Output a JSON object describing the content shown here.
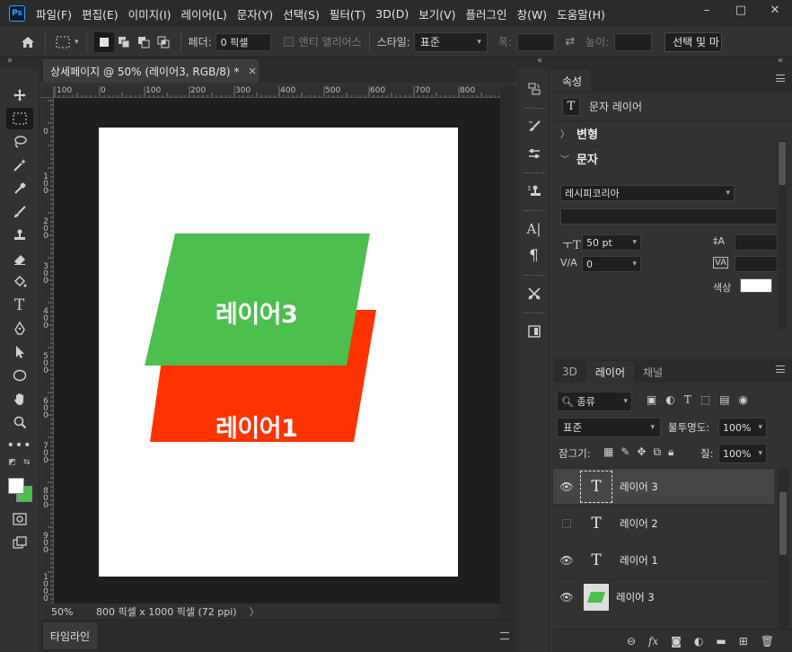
{
  "app": {
    "logo": "Ps",
    "menu": [
      "파일(F)",
      "편집(E)",
      "이미지(I)",
      "레이어(L)",
      "문자(Y)",
      "선택(S)",
      "필터(T)",
      "3D(D)",
      "보기(V)",
      "플러그인",
      "창(W)",
      "도움말(H)"
    ],
    "window_controls": [
      "–",
      "□",
      "✕"
    ]
  },
  "options": {
    "feather_label": "페더:",
    "feather_value": "0 픽셀",
    "antialias_label": "앤티 앨리어스",
    "style_label": "스타일:",
    "style_value": "표준",
    "width_label": "폭:",
    "height_label": "높이:",
    "select_mask_button": "선택 및 마"
  },
  "document": {
    "tab_title": "상세페이지 @ 50% (레이어3, RGB/8) *",
    "tab_close": "✕",
    "ruler_top": [
      "100",
      "0",
      "100",
      "200",
      "300",
      "400",
      "500",
      "600",
      "700",
      "800"
    ],
    "ruler_left": [
      "0",
      "1 0 0",
      "2 0 0",
      "3 0 0",
      "4 0 0",
      "5 0 0",
      "6 0 0",
      "7 0 0",
      "8 0 0",
      "9 0 0",
      "1 0 0 0"
    ],
    "zoom": "50%",
    "doc_info": "800 픽셀 x 1000 픽셀 (72 ppi)",
    "status_arrow": "〉",
    "layer3_text": "레이어3",
    "layer1_text": "레이어1",
    "colors": {
      "green": "#4cbf4f",
      "red": "#ff3300",
      "canvas": "#ffffff"
    }
  },
  "timeline": {
    "tab": "타임라인"
  },
  "properties": {
    "tab": "속성",
    "layer_type_icon": "T",
    "layer_type": "문자 레이어",
    "section_transform": "변형",
    "section_character": "문자",
    "font_family": "레시피코리아",
    "font_size": "50 pt",
    "tracking": "0",
    "color_label": "색상",
    "text_color": "#ffffff"
  },
  "layers_panel": {
    "tabs": [
      "3D",
      "레이어",
      "채널"
    ],
    "filter_kind": "종류",
    "blend_mode": "표준",
    "opacity_label": "불투명도:",
    "opacity_value": "100%",
    "lock_label": "잠그기:",
    "fill_label": "칠:",
    "fill_value": "100%",
    "rows": [
      {
        "name": "레이어 3",
        "type": "text",
        "visible": true,
        "selected": true
      },
      {
        "name": "레이어 2",
        "type": "text",
        "visible": false,
        "selected": false
      },
      {
        "name": "레이어 1",
        "type": "text",
        "visible": true,
        "selected": false
      },
      {
        "name": "레이어 3",
        "type": "shape",
        "visible": true,
        "selected": false
      }
    ],
    "footer_icons": [
      "link-icon",
      "fx-icon",
      "mask-icon",
      "adjustment-icon",
      "folder-icon",
      "new-layer-icon",
      "trash-icon"
    ]
  }
}
